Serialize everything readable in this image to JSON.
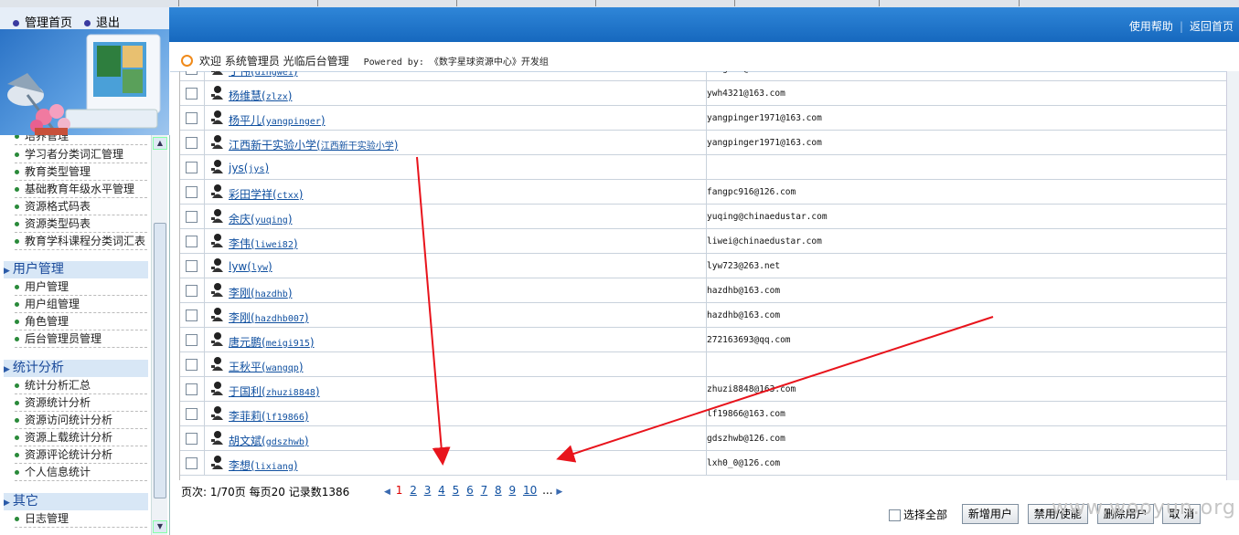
{
  "topnav": {
    "home": "管理首页",
    "logout": "退出"
  },
  "toplinks": {
    "help": "使用帮助",
    "back": "返回首页"
  },
  "welcome": {
    "text": "欢迎 系统管理员 光临后台管理",
    "powered": "Powered by: 《数字星球资源中心》开发组"
  },
  "sidebar": {
    "group0_items": [
      "培养管理",
      "学习者分类词汇管理",
      "教育类型管理",
      "基础教育年级水平管理",
      "资源格式码表",
      "资源类型码表",
      "教育学科课程分类词汇表"
    ],
    "groups": [
      {
        "title": "用户管理",
        "items": [
          "用户管理",
          "用户组管理",
          "角色管理",
          "后台管理员管理"
        ]
      },
      {
        "title": "统计分析",
        "items": [
          "统计分析汇总",
          "资源统计分析",
          "资源访问统计分析",
          "资源上载统计分析",
          "资源评论统计分析",
          "个人信息统计"
        ]
      },
      {
        "title": "其它",
        "items": [
          "日志管理"
        ]
      }
    ]
  },
  "users": [
    {
      "name": "丁伟",
      "id": "dingwei",
      "email": "dingwei@chinaedustar.com"
    },
    {
      "name": "杨维慧",
      "id": "zlzx",
      "email": "ywh4321@163.com"
    },
    {
      "name": "杨平儿",
      "id": "yangpinger",
      "email": "yangpinger1971@163.com"
    },
    {
      "name": "江西新干实验小学",
      "id": "江西新干实验小学",
      "email": "yangpinger1971@163.com"
    },
    {
      "name": "jys",
      "id": "jys",
      "email": ""
    },
    {
      "name": "彩田学祥",
      "id": "ctxx",
      "email": "fangpc916@126.com"
    },
    {
      "name": "余庆",
      "id": "yuqing",
      "email": "yuqing@chinaedustar.com"
    },
    {
      "name": "李伟",
      "id": "liwei82",
      "email": "liwei@chinaedustar.com"
    },
    {
      "name": "lyw",
      "id": "lyw",
      "email": "lyw723@263.net"
    },
    {
      "name": "李刚",
      "id": "hazdhb",
      "email": "hazdhb@163.com"
    },
    {
      "name": "李刚",
      "id": "hazdhb007",
      "email": "hazdhb@163.com"
    },
    {
      "name": "唐元鹏",
      "id": "meigi915",
      "email": "272163693@qq.com"
    },
    {
      "name": "王秋平",
      "id": "wangqp",
      "email": ""
    },
    {
      "name": "于国利",
      "id": "zhuzi8848",
      "email": "zhuzi8848@163.com"
    },
    {
      "name": "李菲莉",
      "id": "lf19866",
      "email": "lf19866@163.com"
    },
    {
      "name": "胡文斌",
      "id": "gdszhwb",
      "email": "gdszhwb@126.com"
    },
    {
      "name": "李想",
      "id": "lixiang",
      "email": "lxh0_0@126.com"
    }
  ],
  "pager": {
    "text": "页次: 1/70页 每页20 记录数1386",
    "pages": [
      "1",
      "2",
      "3",
      "4",
      "5",
      "6",
      "7",
      "8",
      "9",
      "10"
    ],
    "more": "..."
  },
  "actions": {
    "select_all": "选择全部",
    "add_user": "新增用户",
    "toggle": "禁用/使能",
    "delete": "删除用户",
    "cancel": "取 消"
  },
  "watermark": "www.wooyun.org",
  "colors": {
    "topbar": "#1f78cf",
    "link": "#1050a0",
    "annotation_arrow": "#e8141c"
  }
}
